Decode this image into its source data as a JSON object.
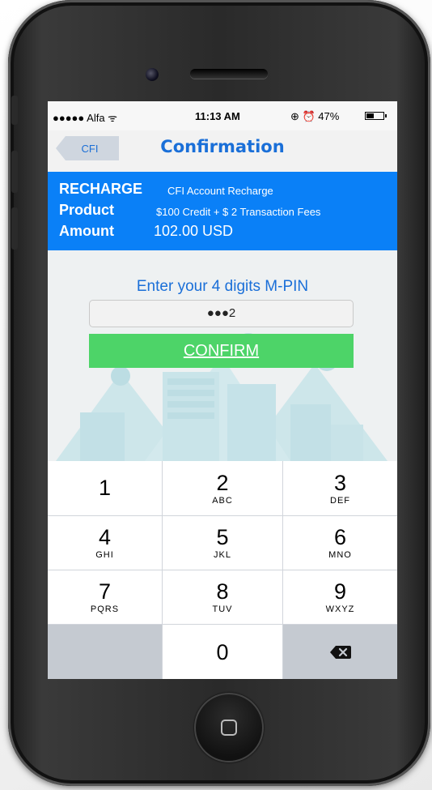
{
  "status_bar": {
    "carrier": "●●●●● Alfa ᯤ",
    "time": "11:13 AM",
    "right": "⊕ ⏰ 47%",
    "battery_level": 0.47
  },
  "nav": {
    "back_label": "CFI",
    "title": "Confirmation"
  },
  "info": {
    "recharge_key": "RECHARGE",
    "recharge_value": "CFI Account Recharge",
    "product_key": "Product",
    "product_value": "$100 Credit + $ 2 Transaction Fees",
    "amount_key": "Amount",
    "amount_value": "102.00 USD"
  },
  "pin": {
    "prompt": "Enter your 4 digits M-PIN",
    "value": "●●●2",
    "confirm_label": "CONFIRM"
  },
  "keypad": {
    "keys": [
      {
        "num": "1",
        "letters": ""
      },
      {
        "num": "2",
        "letters": "ABC"
      },
      {
        "num": "3",
        "letters": "DEF"
      },
      {
        "num": "4",
        "letters": "GHI"
      },
      {
        "num": "5",
        "letters": "JKL"
      },
      {
        "num": "6",
        "letters": "MNO"
      },
      {
        "num": "7",
        "letters": "PQRS"
      },
      {
        "num": "8",
        "letters": "TUV"
      },
      {
        "num": "9",
        "letters": "WXYZ"
      },
      {
        "num": "0",
        "letters": ""
      }
    ],
    "delete_icon": "backspace-icon"
  },
  "colors": {
    "accent_blue": "#0a80f7",
    "title_blue": "#1a6fd8",
    "confirm_green": "#4dd468"
  }
}
